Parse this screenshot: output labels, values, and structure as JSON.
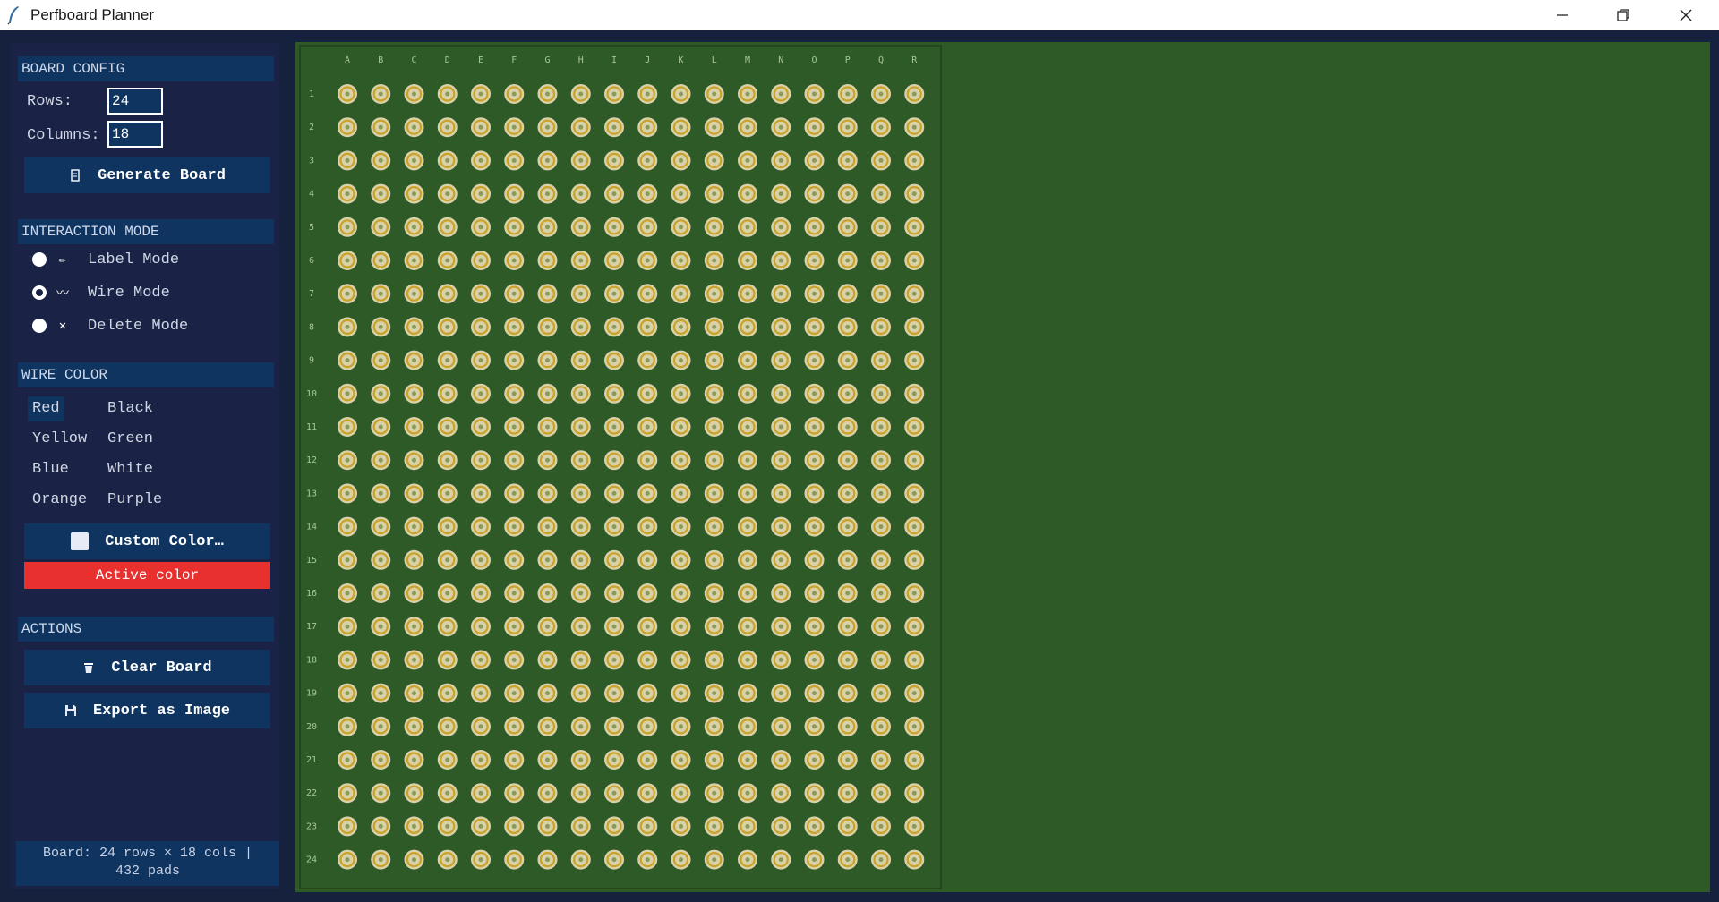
{
  "window": {
    "title": "Perfboard Planner"
  },
  "board_config": {
    "header": "BOARD CONFIG",
    "rows_label": "Rows:",
    "rows_value": "24",
    "columns_label": "Columns:",
    "columns_value": "18",
    "generate_label": "Generate Board"
  },
  "interaction_mode": {
    "header": "INTERACTION MODE",
    "modes": [
      {
        "label": "Label Mode",
        "icon": "pencil-icon",
        "glyph": "✏",
        "checked": false
      },
      {
        "label": "Wire Mode",
        "icon": "wave-icon",
        "glyph": "〰",
        "checked": true
      },
      {
        "label": "Delete Mode",
        "icon": "x-icon",
        "glyph": "✕",
        "checked": false
      }
    ]
  },
  "wire_color": {
    "header": "WIRE COLOR",
    "colors": [
      "Red",
      "Black",
      "Yellow",
      "Green",
      "Blue",
      "White",
      "Orange",
      "Purple"
    ],
    "selected": "Red",
    "custom_label": "Custom Color…",
    "active_label": "Active color",
    "active_hex": "#e8302f"
  },
  "actions": {
    "header": "ACTIONS",
    "clear_label": "Clear Board",
    "export_label": "Export as Image"
  },
  "status": {
    "line1": "Board: 24 rows × 18 cols  |",
    "line2": "432 pads"
  },
  "board": {
    "rows": 24,
    "columns": [
      "A",
      "B",
      "C",
      "D",
      "E",
      "F",
      "G",
      "H",
      "I",
      "J",
      "K",
      "L",
      "M",
      "N",
      "O",
      "P",
      "Q",
      "R"
    ],
    "row_labels": [
      "1",
      "2",
      "3",
      "4",
      "5",
      "6",
      "7",
      "8",
      "9",
      "10",
      "11",
      "12",
      "13",
      "14",
      "15",
      "16",
      "17",
      "18",
      "19",
      "20",
      "21",
      "22",
      "23",
      "24"
    ],
    "board_color": "#2d5a27",
    "pad_ring_color": "#d9d1a8",
    "pad_center_color": "#c9a227"
  }
}
